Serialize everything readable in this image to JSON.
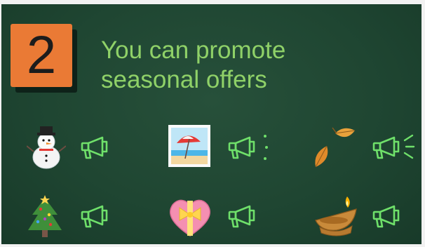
{
  "badge": {
    "number": "2",
    "color": "#ea7a35"
  },
  "headline": {
    "line1": "You can promote",
    "line2": "seasonal offers",
    "color": "#8fd168"
  },
  "grid": [
    {
      "emoji": "snowman-icon",
      "megaphone": "megaphone-icon",
      "sound": "none"
    },
    {
      "emoji": "beach-picture-icon",
      "megaphone": "megaphone-icon",
      "sound": "dots"
    },
    {
      "emoji": "falling-leaves-icon",
      "megaphone": "megaphone-icon",
      "sound": "waves"
    },
    {
      "emoji": "christmas-tree-icon",
      "megaphone": "megaphone-icon",
      "sound": "none"
    },
    {
      "emoji": "heart-ribbon-icon",
      "megaphone": "megaphone-icon",
      "sound": "none"
    },
    {
      "emoji": "diya-lamp-icon",
      "megaphone": "megaphone-icon",
      "sound": "none"
    }
  ],
  "colors": {
    "background": "#1f4632",
    "megaphone": "#6fe06a"
  }
}
